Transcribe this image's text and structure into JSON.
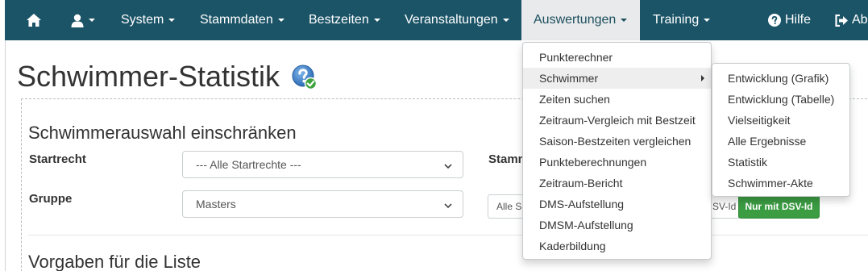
{
  "navbar": {
    "home_icon": "home-icon",
    "user_icon": "user-icon",
    "items": [
      {
        "label": "System"
      },
      {
        "label": "Stammdaten"
      },
      {
        "label": "Bestzeiten"
      },
      {
        "label": "Veranstaltungen"
      },
      {
        "label": "Auswertungen"
      },
      {
        "label": "Training"
      }
    ],
    "help_label": "Hilfe",
    "logout_label": "Ab",
    "color": "#1b5467"
  },
  "page": {
    "title": "Schwimmer-Statistik",
    "panel_title": "Schwimmerauswahl einschränken",
    "startrecht_label": "Startrecht",
    "startrecht_value": "--- Alle Startrechte ---",
    "gruppe_label": "Gruppe",
    "gruppe_value": "Masters",
    "stamm_label": "Stamm",
    "alle_button": "Alle S",
    "dsv_partial": "SV-Id",
    "nur_dsv_button": "Nur mit DSV-Id",
    "section_title": "Vorgaben für die Liste"
  },
  "auswertungen_menu": {
    "items": [
      {
        "label": "Punkterechner"
      },
      {
        "label": "Schwimmer"
      },
      {
        "label": "Zeiten suchen"
      },
      {
        "label": "Zeitraum-Vergleich mit Bestzeit"
      },
      {
        "label": "Saison-Bestzeiten vergleichen"
      },
      {
        "label": "Punkteberechnungen"
      },
      {
        "label": "Zeitraum-Bericht"
      },
      {
        "label": "DMS-Aufstellung"
      },
      {
        "label": "DMSM-Aufstellung"
      },
      {
        "label": "Kaderbildung"
      }
    ]
  },
  "schwimmer_submenu": {
    "items": [
      {
        "label": "Entwicklung (Grafik)"
      },
      {
        "label": "Entwicklung (Tabelle)"
      },
      {
        "label": "Vielseitigkeit"
      },
      {
        "label": "Alle Ergebnisse"
      },
      {
        "label": "Statistik"
      },
      {
        "label": "Schwimmer-Akte"
      }
    ]
  }
}
